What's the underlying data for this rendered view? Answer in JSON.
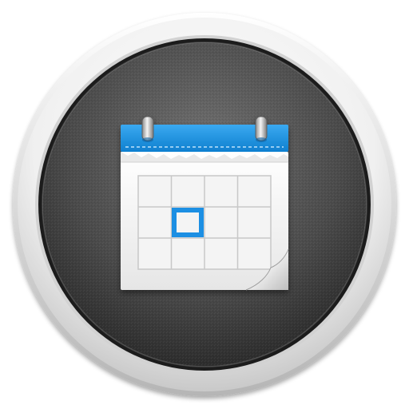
{
  "icon": {
    "name": "calendar-app-icon",
    "colors": {
      "bezel_light": "#ffffff",
      "bezel_dark": "#b8b8b8",
      "dial_inner": "#6b6b6b",
      "dial_outer": "#2a2a2a",
      "calendar_header": "#1e94e0",
      "calendar_header_dark": "#0f78c4",
      "calendar_paper": "#f2f2f2",
      "grid_line": "#c9c9c9",
      "selected_day": "#1a8fe3"
    },
    "grid": {
      "columns": 4,
      "rows": 3,
      "selected_cell": {
        "row": 2,
        "column": 2
      }
    }
  }
}
